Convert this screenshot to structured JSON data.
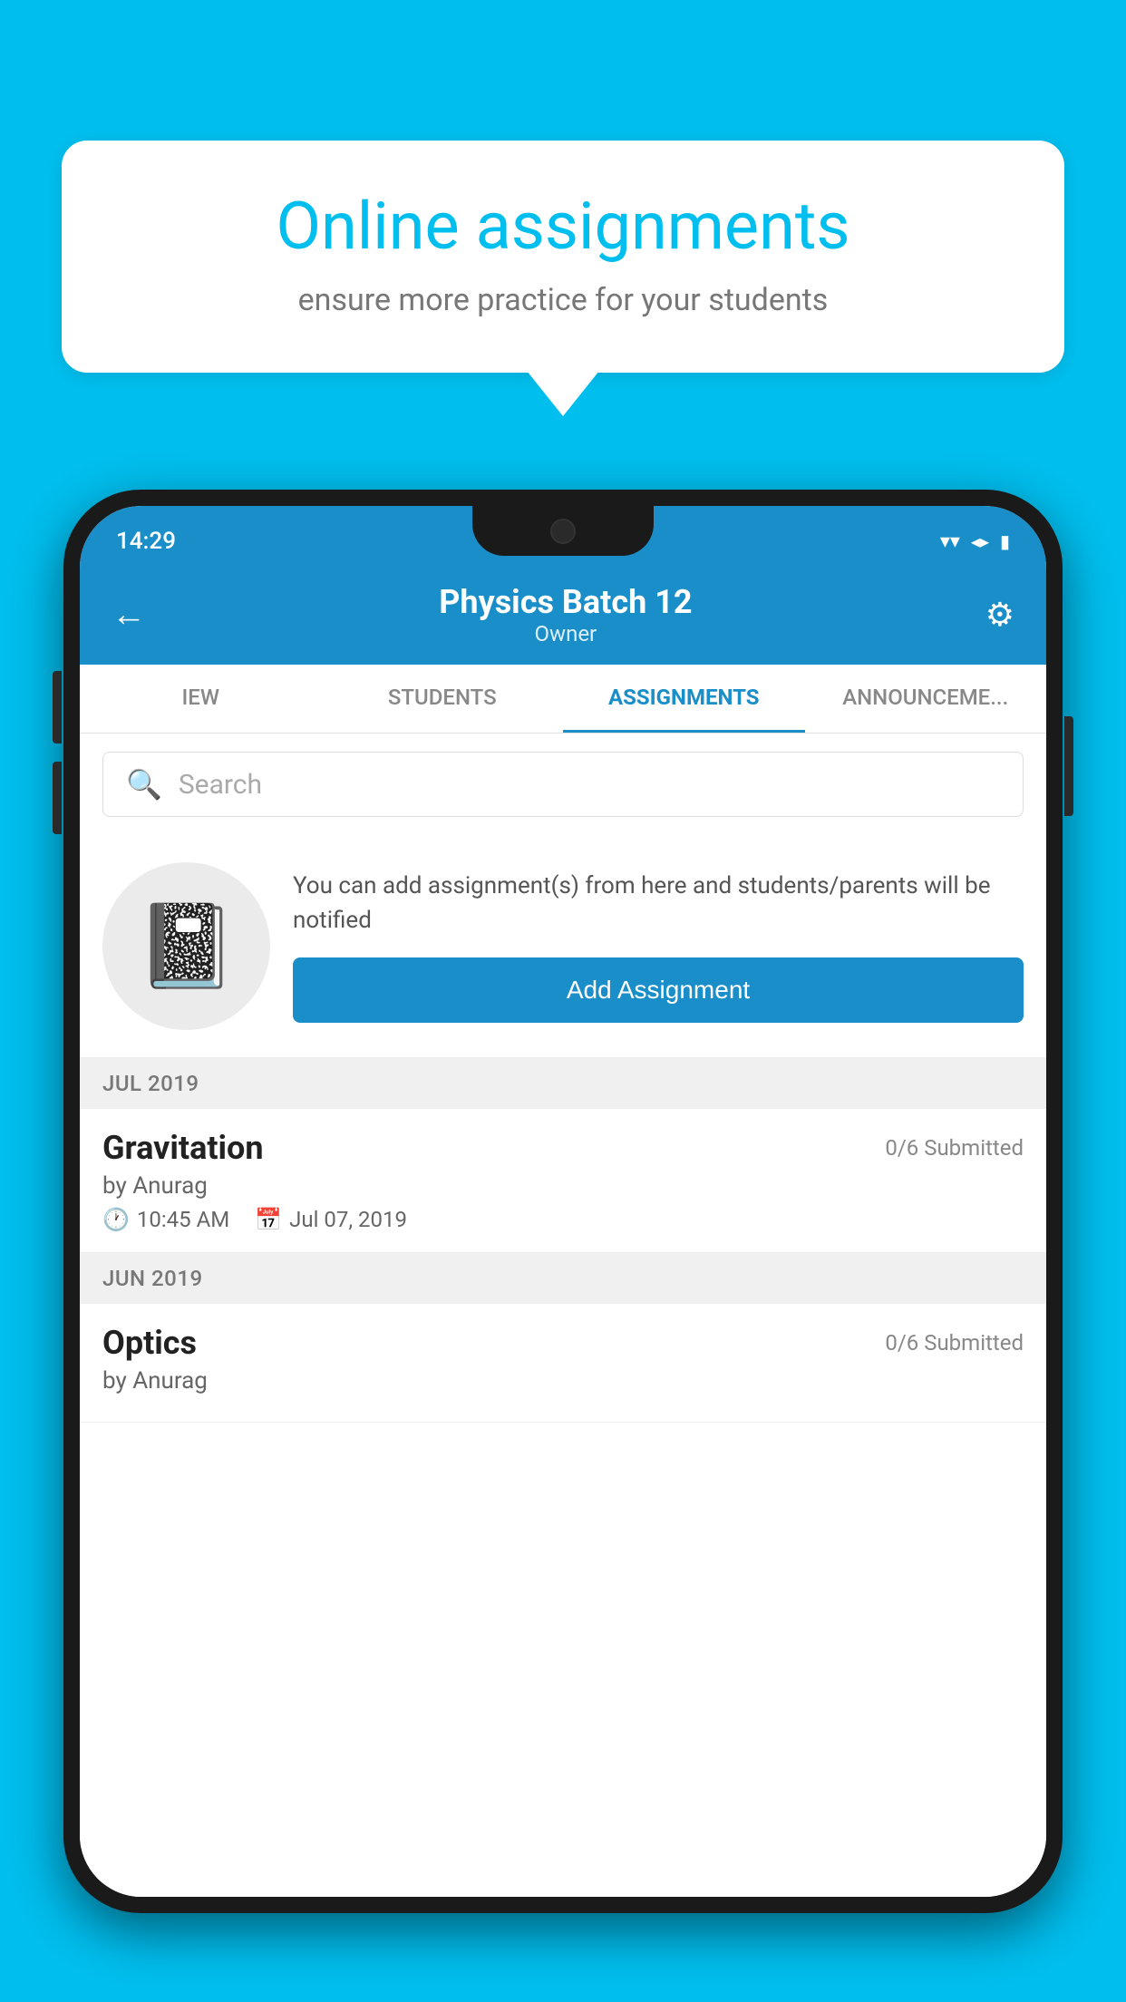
{
  "background_color": "#00BFEF",
  "speech_bubble": {
    "title": "Online assignments",
    "subtitle": "ensure more practice for your students"
  },
  "status_bar": {
    "time": "14:29",
    "wifi_icon": "▾",
    "signal_icon": "▲",
    "battery_icon": "▮"
  },
  "toolbar": {
    "back_icon": "←",
    "title": "Physics Batch 12",
    "subtitle": "Owner",
    "settings_icon": "⚙"
  },
  "tabs": [
    {
      "id": "iew",
      "label": "IEW",
      "active": false
    },
    {
      "id": "students",
      "label": "STUDENTS",
      "active": false
    },
    {
      "id": "assignments",
      "label": "ASSIGNMENTS",
      "active": true
    },
    {
      "id": "announcements",
      "label": "ANNOUNCEMENTS",
      "active": false
    }
  ],
  "search": {
    "placeholder": "Search"
  },
  "promo": {
    "text": "You can add assignment(s) from here and students/parents will be notified",
    "button_label": "Add Assignment"
  },
  "sections": [
    {
      "id": "jul2019",
      "header": "JUL 2019",
      "assignments": [
        {
          "id": "gravitation",
          "name": "Gravitation",
          "submitted": "0/6 Submitted",
          "author": "by Anurag",
          "time": "10:45 AM",
          "date": "Jul 07, 2019"
        }
      ]
    },
    {
      "id": "jun2019",
      "header": "JUN 2019",
      "assignments": [
        {
          "id": "optics",
          "name": "Optics",
          "submitted": "0/6 Submitted",
          "author": "by Anurag",
          "time": "",
          "date": ""
        }
      ]
    }
  ]
}
